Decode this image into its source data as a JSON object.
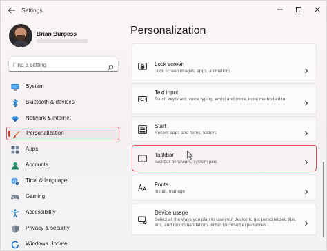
{
  "window": {
    "title": "Settings"
  },
  "user": {
    "name": "Brian Burgess"
  },
  "search": {
    "placeholder": "Find a setting"
  },
  "sidebar": {
    "items": [
      {
        "label": "System",
        "icon": "monitor-icon"
      },
      {
        "label": "Bluetooth & devices",
        "icon": "bluetooth-icon"
      },
      {
        "label": "Network & internet",
        "icon": "wifi-icon"
      },
      {
        "label": "Personalization",
        "icon": "paintbrush-icon",
        "selected": true
      },
      {
        "label": "Apps",
        "icon": "apps-grid-icon"
      },
      {
        "label": "Accounts",
        "icon": "person-icon"
      },
      {
        "label": "Time & language",
        "icon": "globe-clock-icon"
      },
      {
        "label": "Gaming",
        "icon": "gamepad-icon"
      },
      {
        "label": "Accessibility",
        "icon": "accessibility-icon"
      },
      {
        "label": "Privacy & security",
        "icon": "shield-icon"
      },
      {
        "label": "Windows Update",
        "icon": "update-icon"
      }
    ]
  },
  "main": {
    "title": "Personalization",
    "cards": [
      {
        "title": "Lock screen",
        "desc": "Lock screen images, apps, animations",
        "icon": "lock-screen-icon"
      },
      {
        "title": "Text input",
        "desc": "Touch keyboard, voice typing, emoji and more, input method editor",
        "icon": "keyboard-icon"
      },
      {
        "title": "Start",
        "desc": "Recent apps and items, folders",
        "icon": "start-menu-icon"
      },
      {
        "title": "Taskbar",
        "desc": "Taskbar behaviors, system pins",
        "icon": "taskbar-icon",
        "highlighted": true
      },
      {
        "title": "Fonts",
        "desc": "Install, manage",
        "icon": "fonts-icon"
      },
      {
        "title": "Device usage",
        "desc": "Select all the ways you plan to use your device to get personalized tips, ads, and recommendations within Microsoft experiences.",
        "icon": "device-usage-icon"
      }
    ]
  },
  "colors": {
    "accent": "#b7472a",
    "highlight_border": "#d9525f",
    "icon_blue": "#0f6cbd"
  }
}
